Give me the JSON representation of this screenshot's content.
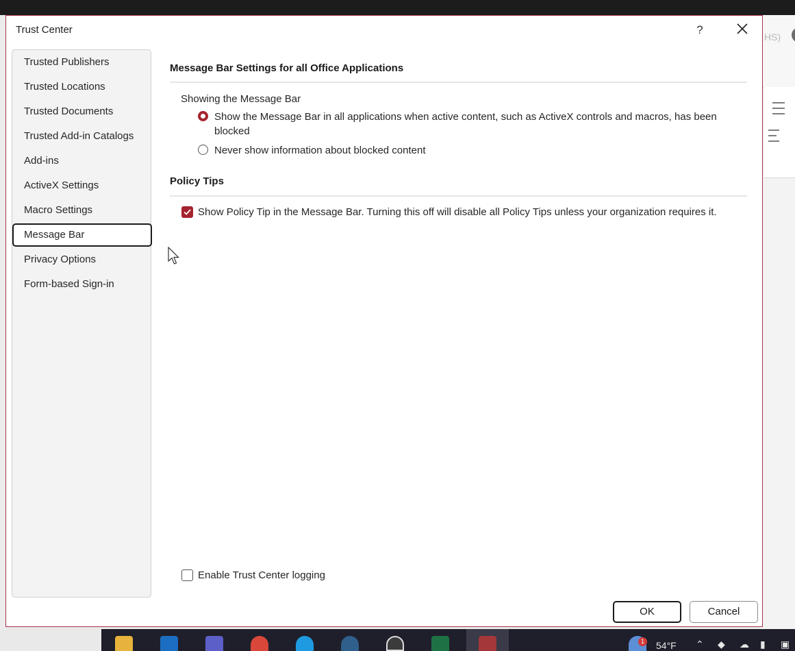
{
  "dialog": {
    "title": "Trust Center",
    "help_label": "?",
    "close_icon": "close-icon"
  },
  "nav": {
    "items": [
      {
        "label": "Trusted Publishers"
      },
      {
        "label": "Trusted Locations"
      },
      {
        "label": "Trusted Documents"
      },
      {
        "label": "Trusted Add-in Catalogs"
      },
      {
        "label": "Add-ins"
      },
      {
        "label": "ActiveX Settings"
      },
      {
        "label": "Macro Settings"
      },
      {
        "label": "Message Bar"
      },
      {
        "label": "Privacy Options"
      },
      {
        "label": "Form-based Sign-in"
      }
    ],
    "selected": "Message Bar"
  },
  "message_bar": {
    "heading": "Message Bar Settings for all Office Applications",
    "group_label": "Showing the Message Bar",
    "option_show_line1": "Show the Message Bar in all applications when active content, such as ActiveX controls and macros, has been",
    "option_show_line2": "blocked",
    "option_never": "Never show information about blocked content",
    "selected_option": "show"
  },
  "policy_tips": {
    "heading": "Policy Tips",
    "checkbox_label": "Show Policy Tip in the Message Bar. Turning this off will disable all Policy Tips unless your organization requires it.",
    "checked": true
  },
  "logging": {
    "checkbox_label": "Enable Trust Center logging",
    "checked": false
  },
  "buttons": {
    "ok": "OK",
    "cancel": "Cancel"
  },
  "background": {
    "partial_label": "HS)"
  },
  "taskbar": {
    "notification_count": "1",
    "temperature": "54°F",
    "accent": "#a4242f"
  }
}
